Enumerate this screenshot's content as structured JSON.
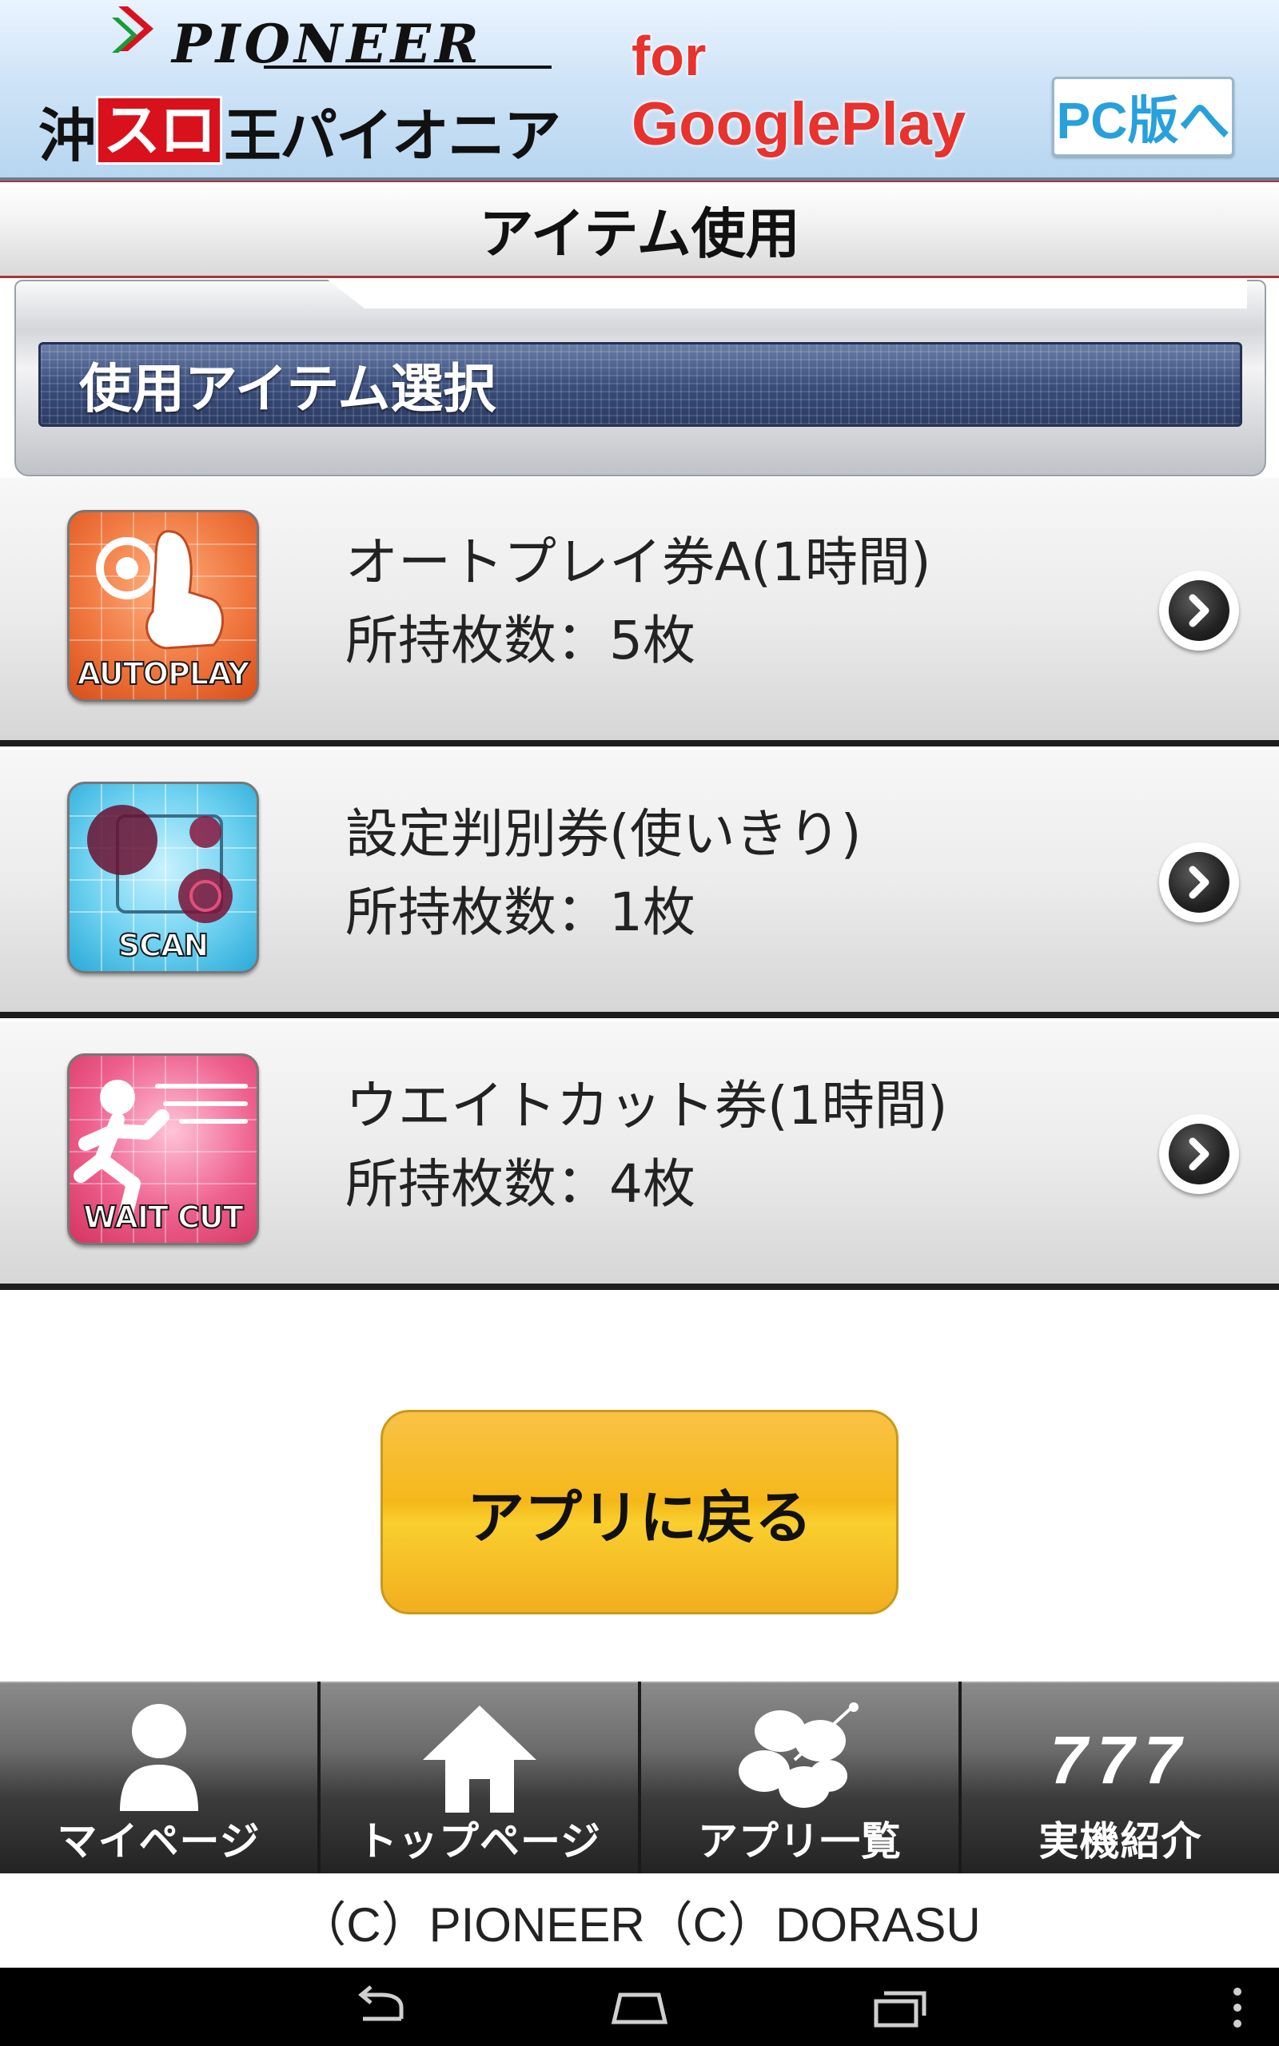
{
  "header": {
    "brand_pioneer": "PIONEER",
    "brand_title_prefix": "沖",
    "brand_title_box": "スロ",
    "brand_title_suffix": "王パイオニア",
    "for_label": "for",
    "platform_label": "GooglePlay",
    "pc_version_button": "PC版へ"
  },
  "page_title": "アイテム使用",
  "section_title": "使用アイテム選択",
  "items": [
    {
      "name": "オートプレイ券A(1時間)",
      "count_text": "所持枚数：5枚",
      "icon_caption": "AUTOPLAY",
      "icon_color": "#f07840"
    },
    {
      "name": "設定判別券(使いきり)",
      "count_text": "所持枚数：1枚",
      "icon_caption": "SCAN",
      "icon_color": "#6ed2f0"
    },
    {
      "name": "ウエイトカット券(1時間)",
      "count_text": "所持枚数：4枚",
      "icon_caption": "WAIT CUT",
      "icon_color": "#ee5f8e"
    }
  ],
  "back_button": "アプリに戻る",
  "nav": {
    "items": [
      {
        "label": "マイページ",
        "icon": "person-icon"
      },
      {
        "label": "トップページ",
        "icon": "home-icon"
      },
      {
        "label": "アプリ一覧",
        "icon": "hibiscus-icon"
      },
      {
        "label": "実機紹介",
        "icon": "777-icon",
        "icon_text": "777"
      }
    ]
  },
  "footer": "（C）PIONEER（C）DORASU",
  "colors": {
    "accent_red": "#e8322e",
    "button_orange": "#f5b81a",
    "pc_button_text": "#28a0dc"
  }
}
